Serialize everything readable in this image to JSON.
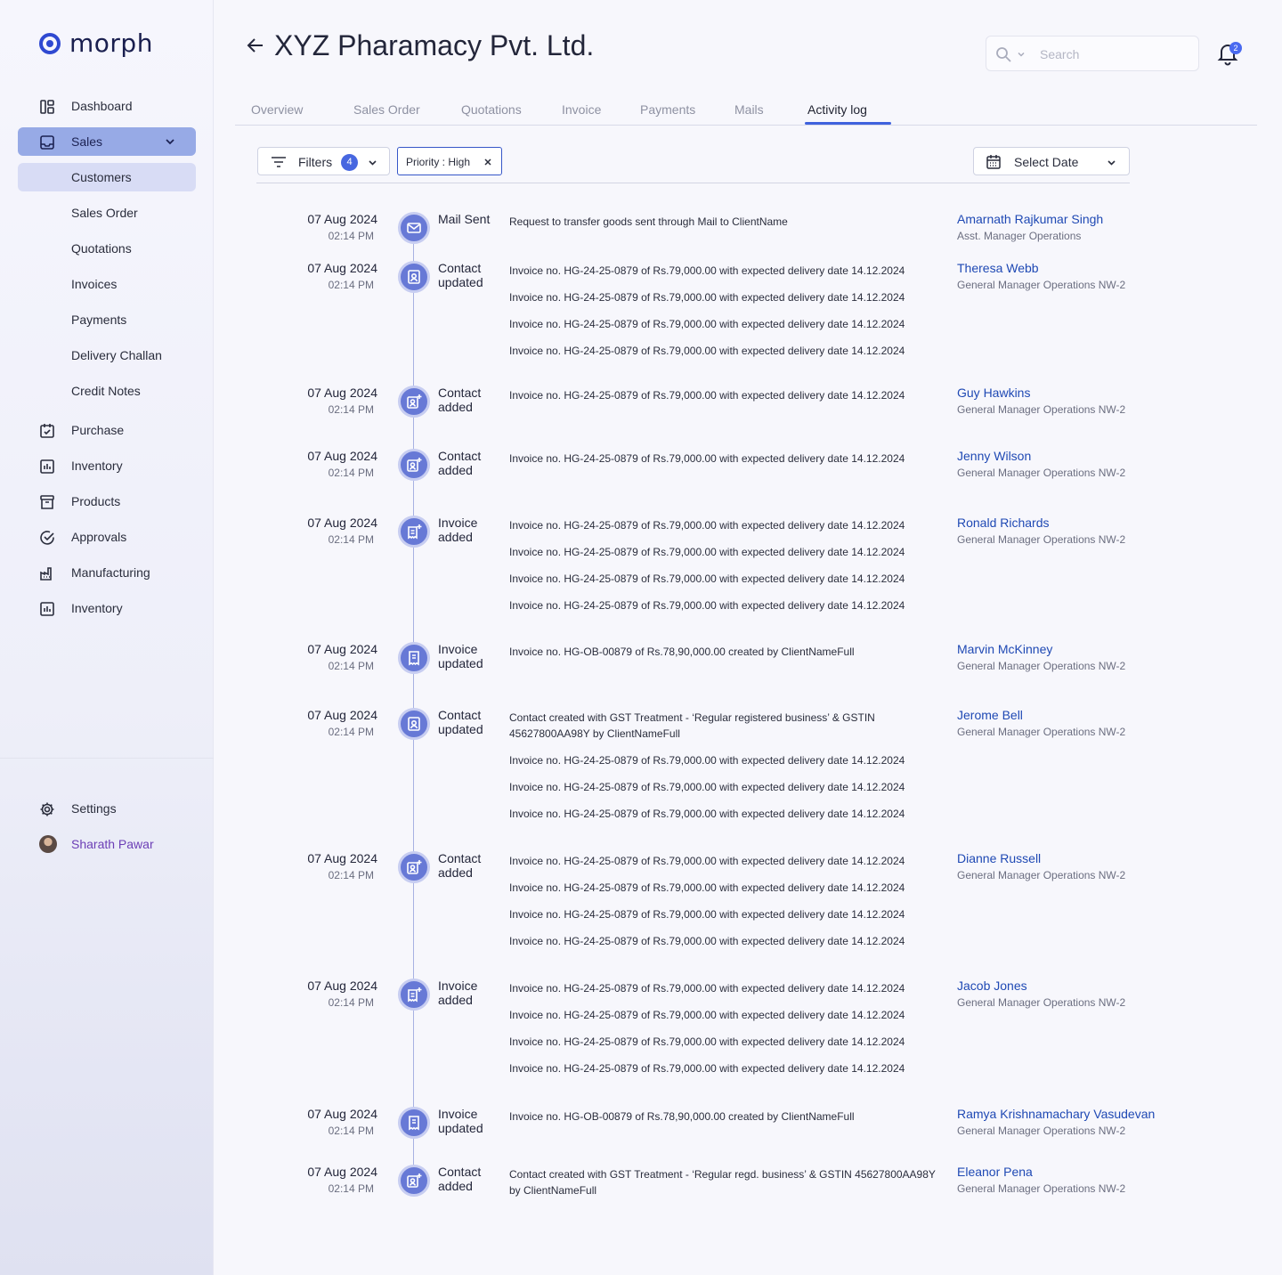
{
  "brand": {
    "name": "morph",
    "color": "#2f49d1"
  },
  "sidebar": {
    "items": [
      {
        "label": "Dashboard",
        "icon": "dashboard-icon"
      },
      {
        "label": "Sales",
        "icon": "inbox-icon"
      },
      {
        "label": "Customers"
      },
      {
        "label": "Sales Order"
      },
      {
        "label": "Quotations"
      },
      {
        "label": "Invoices"
      },
      {
        "label": "Payments"
      },
      {
        "label": "Delivery Challan"
      },
      {
        "label": "Credit Notes"
      },
      {
        "label": "Purchase",
        "icon": "purchase-icon"
      },
      {
        "label": "Inventory",
        "icon": "chart-box-icon"
      },
      {
        "label": "Products",
        "icon": "archive-icon"
      },
      {
        "label": "Approvals",
        "icon": "check-circle-icon"
      },
      {
        "label": "Manufacturing",
        "icon": "factory-icon"
      },
      {
        "label": "Inventory",
        "icon": "chart-box-icon"
      }
    ],
    "settings": "Settings",
    "user": "Sharath Pawar"
  },
  "header": {
    "title": "XYZ Pharamacy Pvt. Ltd.",
    "search_placeholder": "Search",
    "notification_count": "2"
  },
  "tabs": [
    "Overview",
    "Sales Order",
    "Quotations",
    "Invoice",
    "Payments",
    "Mails",
    "Activity log"
  ],
  "active_tab": "Activity log",
  "filters": {
    "label": "Filters",
    "count": "4",
    "chip": "Priority : High",
    "date_label": "Select Date"
  },
  "activity": [
    {
      "date": "07 Aug 2024",
      "time": "02:14 PM",
      "type": "Mail Sent",
      "icon": "mail-icon",
      "messages": [
        "Request to transfer goods sent through Mail to ClientName"
      ],
      "user": "Amarnath Rajkumar Singh",
      "role": "Asst. Manager Operations"
    },
    {
      "date": "07 Aug 2024",
      "time": "02:14 PM",
      "type": "Contact updated",
      "icon": "contact-icon",
      "messages": [
        "Invoice no. HG-24-25-0879 of Rs.79,000.00 with expected delivery date 14.12.2024",
        "Invoice no. HG-24-25-0879 of Rs.79,000.00 with expected delivery date 14.12.2024",
        "Invoice no. HG-24-25-0879 of Rs.79,000.00 with expected delivery date 14.12.2024",
        "Invoice no. HG-24-25-0879 of Rs.79,000.00 with expected delivery date 14.12.2024"
      ],
      "user": "Theresa Webb",
      "role": "General Manager Operations NW-2"
    },
    {
      "date": "07 Aug 2024",
      "time": "02:14 PM",
      "type": "Contact added",
      "icon": "contact-add-icon",
      "messages": [
        "Invoice no. HG-24-25-0879 of Rs.79,000.00 with expected delivery date 14.12.2024"
      ],
      "user": "Guy Hawkins",
      "role": "General Manager Operations NW-2"
    },
    {
      "date": "07 Aug 2024",
      "time": "02:14 PM",
      "type": "Contact added",
      "icon": "contact-add-icon",
      "messages": [
        "Invoice no. HG-24-25-0879 of Rs.79,000.00 with expected delivery date 14.12.2024"
      ],
      "user": "Jenny Wilson",
      "role": "General Manager Operations NW-2"
    },
    {
      "date": "07 Aug 2024",
      "time": "02:14 PM",
      "type": "Invoice added",
      "icon": "invoice-add-icon",
      "messages": [
        "Invoice no. HG-24-25-0879 of Rs.79,000.00 with expected delivery date 14.12.2024",
        "Invoice no. HG-24-25-0879 of Rs.79,000.00 with expected delivery date 14.12.2024",
        "Invoice no. HG-24-25-0879 of Rs.79,000.00 with expected delivery date 14.12.2024",
        "Invoice no. HG-24-25-0879 of Rs.79,000.00 with expected delivery date 14.12.2024"
      ],
      "user": "Ronald Richards",
      "role": "General Manager Operations NW-2"
    },
    {
      "date": "07 Aug 2024",
      "time": "02:14 PM",
      "type": "Invoice updated",
      "icon": "invoice-icon",
      "messages": [
        "Invoice no. HG-OB-00879 of Rs.78,90,000.00 created by ClientNameFull"
      ],
      "user": "Marvin McKinney",
      "role": "General Manager Operations NW-2"
    },
    {
      "date": "07 Aug 2024",
      "time": "02:14 PM",
      "type": "Contact updated",
      "icon": "contact-icon",
      "messages": [
        "Contact created with GST Treatment - ‘Regular registered business’ & GSTIN 45627800AA98Y by ClientNameFull",
        "Invoice no. HG-24-25-0879 of Rs.79,000.00 with expected delivery date 14.12.2024",
        "Invoice no. HG-24-25-0879 of Rs.79,000.00 with expected delivery date 14.12.2024",
        "Invoice no. HG-24-25-0879 of Rs.79,000.00 with expected delivery date 14.12.2024"
      ],
      "user": "Jerome Bell",
      "role": "General Manager Operations NW-2"
    },
    {
      "date": "07 Aug 2024",
      "time": "02:14 PM",
      "type": "Contact added",
      "icon": "contact-add-icon",
      "messages": [
        "Invoice no. HG-24-25-0879 of Rs.79,000.00 with expected delivery date 14.12.2024",
        "Invoice no. HG-24-25-0879 of Rs.79,000.00 with expected delivery date 14.12.2024",
        "Invoice no. HG-24-25-0879 of Rs.79,000.00 with expected delivery date 14.12.2024",
        "Invoice no. HG-24-25-0879 of Rs.79,000.00 with expected delivery date 14.12.2024"
      ],
      "user": "Dianne Russell",
      "role": "General Manager Operations NW-2"
    },
    {
      "date": "07 Aug 2024",
      "time": "02:14 PM",
      "type": "Invoice added",
      "icon": "invoice-add-icon",
      "messages": [
        "Invoice no. HG-24-25-0879 of Rs.79,000.00 with expected delivery date 14.12.2024",
        "Invoice no. HG-24-25-0879 of Rs.79,000.00 with expected delivery date 14.12.2024",
        "Invoice no. HG-24-25-0879 of Rs.79,000.00 with expected delivery date 14.12.2024",
        "Invoice no. HG-24-25-0879 of Rs.79,000.00 with expected delivery date 14.12.2024"
      ],
      "user": "Jacob Jones",
      "role": "General Manager Operations NW-2"
    },
    {
      "date": "07 Aug 2024",
      "time": "02:14 PM",
      "type": "Invoice updated",
      "icon": "invoice-icon",
      "messages": [
        "Invoice no. HG-OB-00879 of Rs.78,90,000.00 created by ClientNameFull"
      ],
      "user": "Ramya Krishnamachary Vasudevan",
      "role": "General Manager Operations NW-2"
    },
    {
      "date": "07 Aug 2024",
      "time": "02:14 PM",
      "type": "Contact added",
      "icon": "contact-add-icon",
      "messages": [
        "Contact created with GST Treatment - ‘Regular regd. business’ & GSTIN 45627800AA98Y by ClientNameFull"
      ],
      "user": "Eleanor Pena",
      "role": "General Manager Operations NW-2"
    }
  ]
}
